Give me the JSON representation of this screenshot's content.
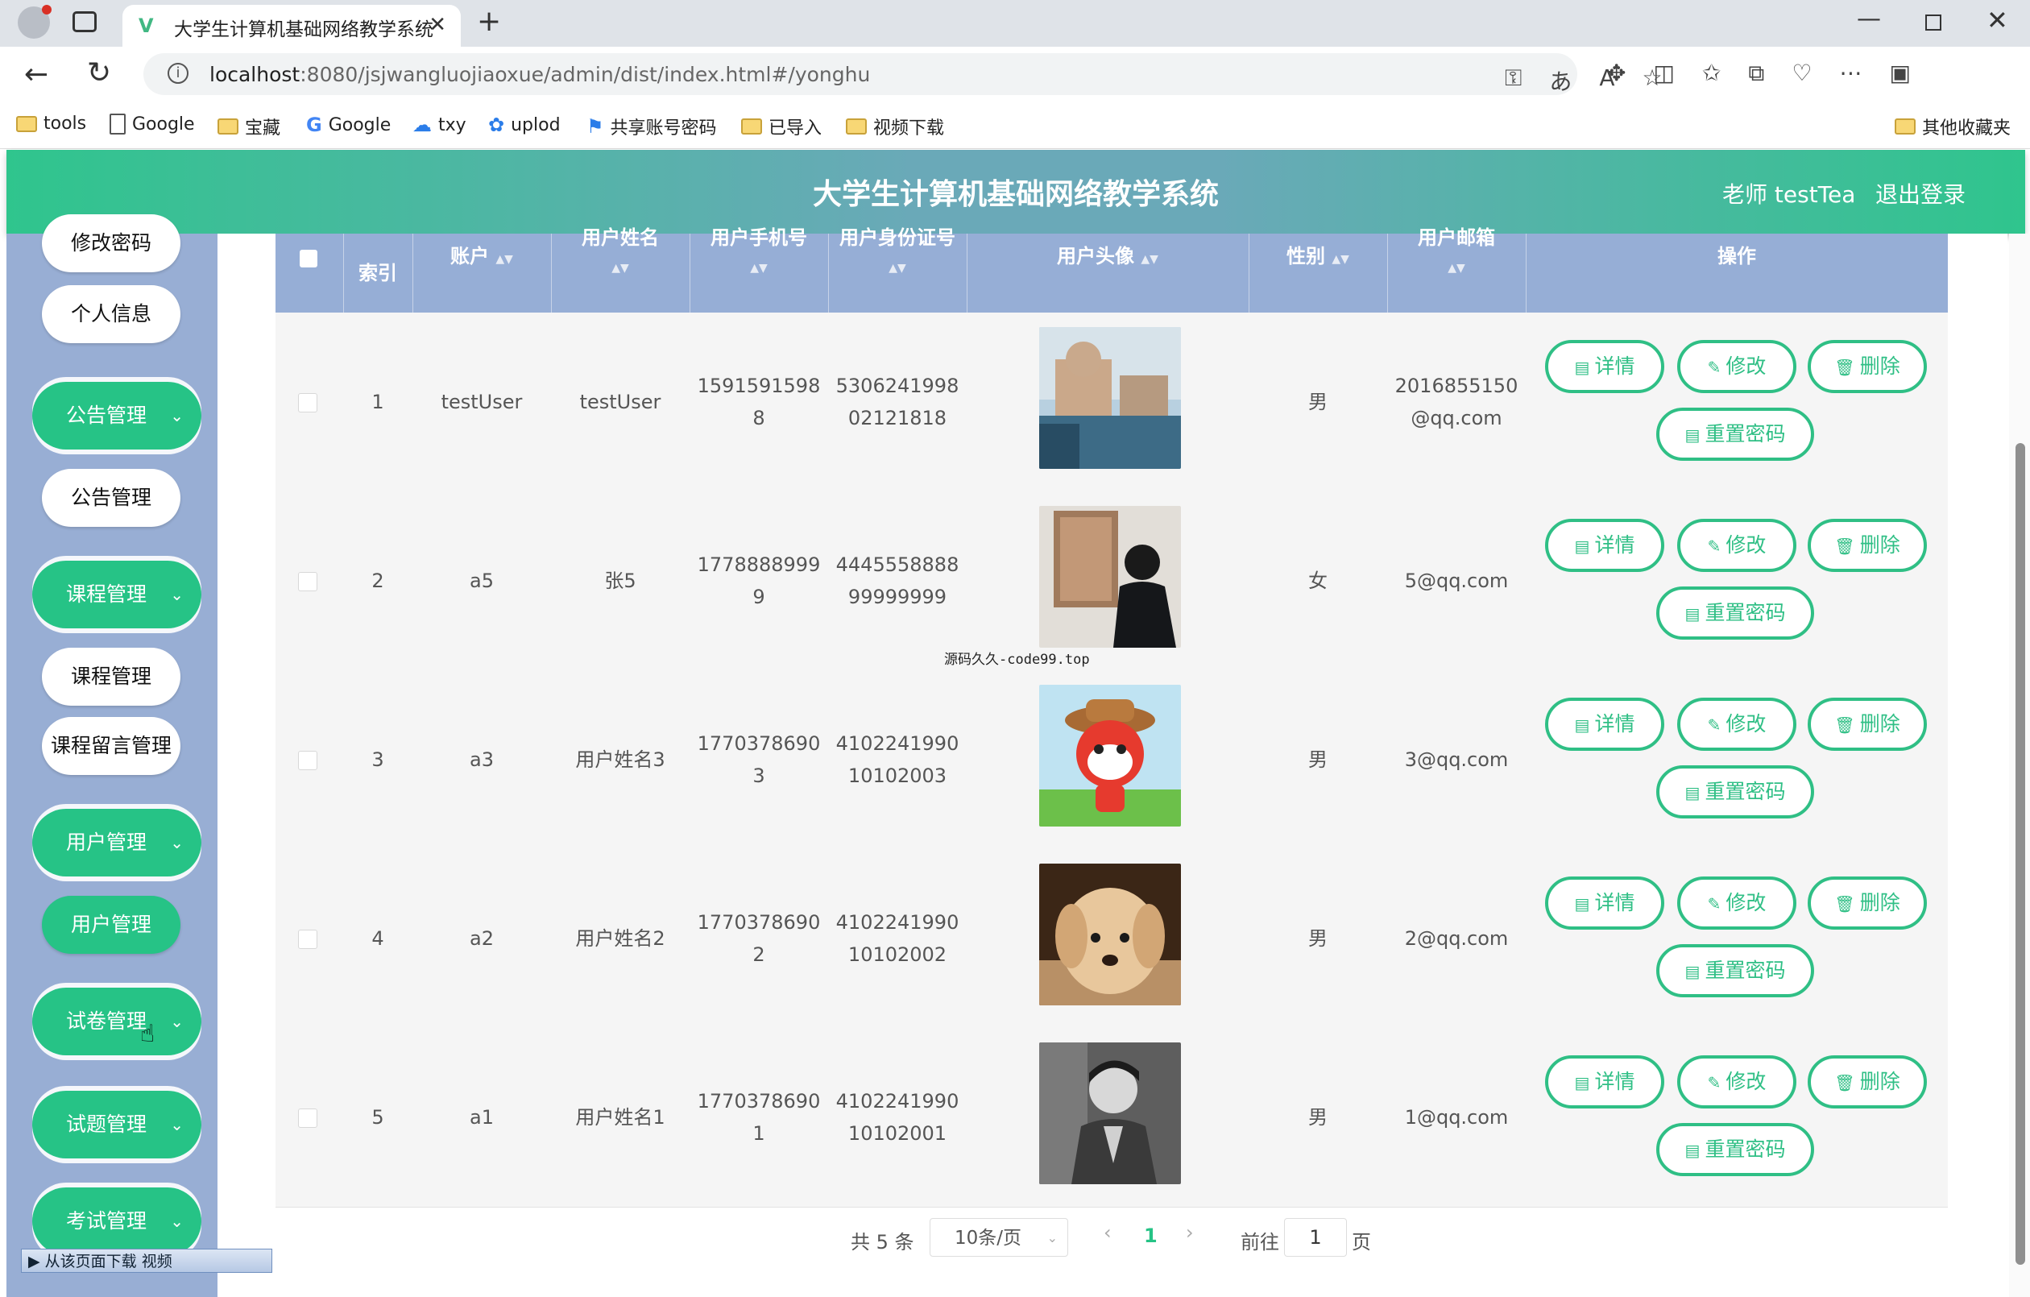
{
  "browser": {
    "tab_title": "大学生计算机基础网络教学系统",
    "url_host": "localhost",
    "url_rest": ":8080/jsjwangluojiaoxue/admin/dist/index.html#/yonghu",
    "bookmarks": [
      "tools",
      "Google",
      "宝藏",
      "Google",
      "txy",
      "uplod",
      "共享账号密码",
      "已导入",
      "视频下载"
    ],
    "other_bookmarks": "其他收藏夹"
  },
  "header": {
    "title": "大学生计算机基础网络教学系统",
    "user": "老师 testTea",
    "logout": "退出登录"
  },
  "sidebar": {
    "top_items": [
      "修改密码",
      "个人信息"
    ],
    "groups": [
      {
        "label": "公告管理",
        "children": [
          "公告管理"
        ]
      },
      {
        "label": "课程管理",
        "children": [
          "课程管理",
          "课程留言管理"
        ]
      },
      {
        "label": "用户管理",
        "children": [
          "用户管理"
        ]
      },
      {
        "label": "试卷管理",
        "children": []
      },
      {
        "label": "试题管理",
        "children": []
      },
      {
        "label": "考试管理",
        "children": []
      }
    ]
  },
  "table": {
    "headers": [
      "索引",
      "账户",
      "用户姓名",
      "用户手机号",
      "用户身份证号",
      "用户头像",
      "性别",
      "用户邮箱",
      "操作"
    ],
    "rows": [
      {
        "index": "1",
        "account": "testUser",
        "name": "testUser",
        "phone_a": "1591591598",
        "phone_b": "8",
        "id_a": "5306241998",
        "id_b": "02121818",
        "avatar": "venice-canal-photo",
        "gender": "男",
        "email_a": "2016855150",
        "email_b": "@qq.com"
      },
      {
        "index": "2",
        "account": "a5",
        "name": "张5",
        "phone_a": "1778888999",
        "phone_b": "9",
        "id_a": "4445558888",
        "id_b": "99999999",
        "avatar": "man-mirror-photo",
        "gender": "女",
        "email_a": "5@qq.com",
        "email_b": ""
      },
      {
        "index": "3",
        "account": "a3",
        "name": "用户姓名3",
        "phone_a": "1770378690",
        "phone_b": "3",
        "id_a": "4102241990",
        "id_b": "10102003",
        "avatar": "cartoon-fox-photo",
        "gender": "男",
        "email_a": "3@qq.com",
        "email_b": ""
      },
      {
        "index": "4",
        "account": "a2",
        "name": "用户姓名2",
        "phone_a": "1770378690",
        "phone_b": "2",
        "id_a": "4102241990",
        "id_b": "10102002",
        "avatar": "puppy-photo",
        "gender": "男",
        "email_a": "2@qq.com",
        "email_b": ""
      },
      {
        "index": "5",
        "account": "a1",
        "name": "用户姓名1",
        "phone_a": "1770378690",
        "phone_b": "1",
        "id_a": "4102241990",
        "id_b": "10102001",
        "avatar": "man-portrait-photo",
        "gender": "男",
        "email_a": "1@qq.com",
        "email_b": ""
      }
    ],
    "actions": {
      "detail": "详情",
      "edit": "修改",
      "delete": "删除",
      "reset": "重置密码"
    }
  },
  "pagination": {
    "total": "共 5 条",
    "page_size": "10条/页",
    "current": "1",
    "goto_label": "前往",
    "goto_value": "1",
    "goto_unit": "页"
  },
  "overlay_text": "源码久久-code99.top",
  "video_bar": "从该页面下载 视频",
  "colors": {
    "accent": "#26c386",
    "header_left": "#2fc58d",
    "sidebar": "#98aed4",
    "thead": "#96aed6"
  }
}
